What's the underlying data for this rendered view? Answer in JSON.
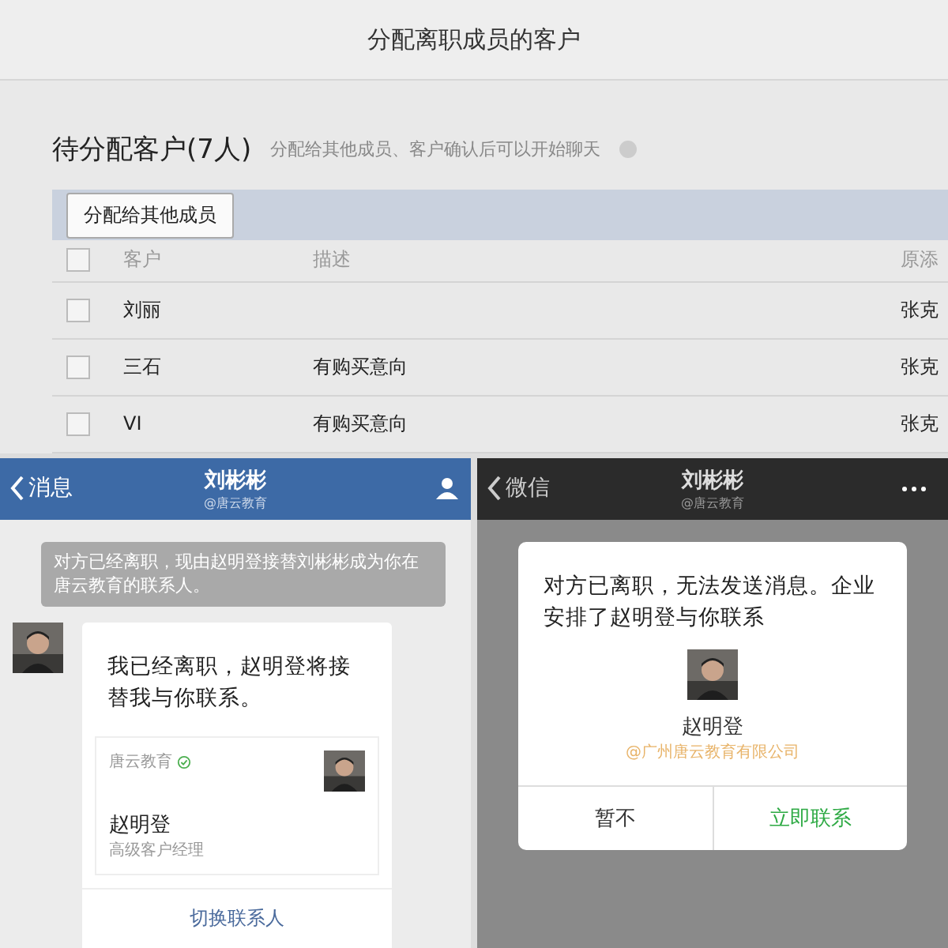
{
  "admin": {
    "title": "分配离职成员的客户",
    "heading": "待分配客户(7人)",
    "hint": "分配给其他成员、客户确认后可以开始聊天",
    "assign_button": "分配给其他成员",
    "table": {
      "columns": [
        "客户",
        "描述",
        "原添"
      ],
      "select_all": {
        "checked": false
      },
      "rows": [
        {
          "name": "刘丽",
          "description": "",
          "column_3": "张克",
          "checked": false
        },
        {
          "name": "三石",
          "description": "有购买意向",
          "column_3": "张克",
          "checked": false
        },
        {
          "name": "VI",
          "description": "有购买意向",
          "column_3": "张克",
          "checked": false
        }
      ]
    }
  },
  "work_chat": {
    "back": "消息",
    "title": "刘彬彬",
    "subtitle": "@唐云教育",
    "notice": "对方已经离职，现由赵明登接替刘彬彬成为你在唐云教育的联系人。",
    "message": "我已经离职，赵明登将接替我与你联系。",
    "card": {
      "company": "唐云教育",
      "name": "赵明登",
      "role": "高级客户经理",
      "action": "切换联系人"
    }
  },
  "wechat": {
    "back": "微信",
    "title": "刘彬彬",
    "subtitle": "@唐云教育",
    "dialog": {
      "message": "对方已离职，无法发送消息。企业安排了赵明登与你联系",
      "name": "赵明登",
      "company": "@广州唐云教育有限公司",
      "buttons": [
        {
          "label": "暂不",
          "kind": "cancel"
        },
        {
          "label": "立即联系",
          "kind": "confirm"
        }
      ]
    }
  }
}
